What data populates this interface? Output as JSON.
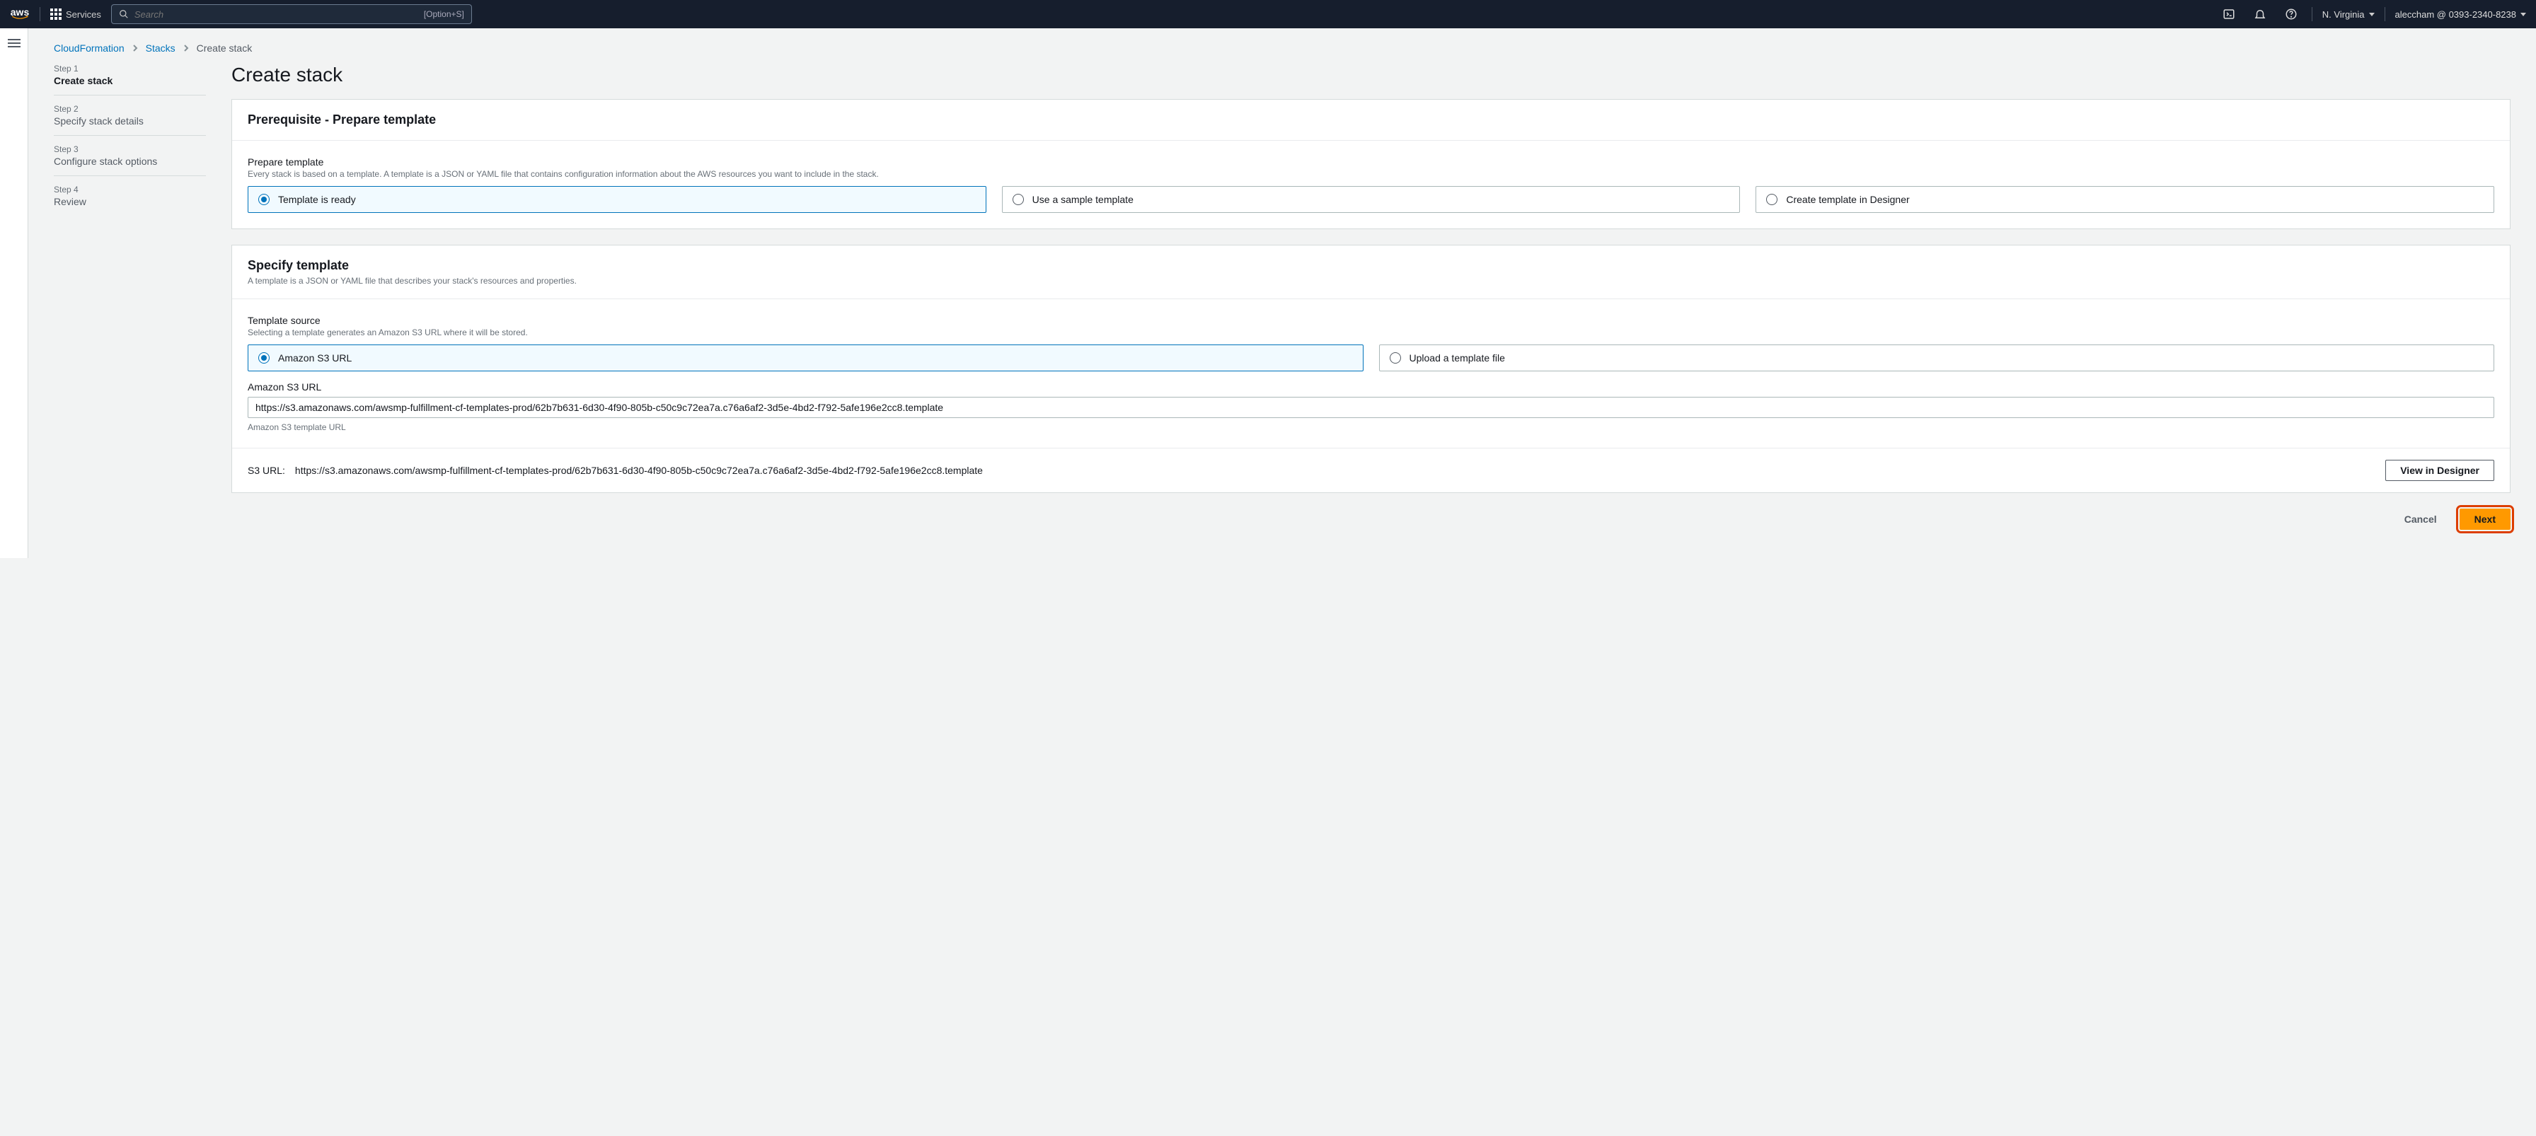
{
  "nav": {
    "logo_text": "aws",
    "services_label": "Services",
    "search_placeholder": "Search",
    "search_hint": "[Option+S]",
    "region": "N. Virginia",
    "account": "aleccham @ 0393-2340-8238"
  },
  "breadcrumb": {
    "items": [
      "CloudFormation",
      "Stacks",
      "Create stack"
    ]
  },
  "steps": [
    {
      "label": "Step 1",
      "title": "Create stack",
      "active": true
    },
    {
      "label": "Step 2",
      "title": "Specify stack details",
      "active": false
    },
    {
      "label": "Step 3",
      "title": "Configure stack options",
      "active": false
    },
    {
      "label": "Step 4",
      "title": "Review",
      "active": false
    }
  ],
  "page_title": "Create stack",
  "prereq": {
    "heading": "Prerequisite - Prepare template",
    "field_label": "Prepare template",
    "field_help": "Every stack is based on a template. A template is a JSON or YAML file that contains configuration information about the AWS resources you want to include in the stack.",
    "options": [
      "Template is ready",
      "Use a sample template",
      "Create template in Designer"
    ]
  },
  "specify": {
    "heading": "Specify template",
    "sub": "A template is a JSON or YAML file that describes your stack's resources and properties.",
    "source_label": "Template source",
    "source_help": "Selecting a template generates an Amazon S3 URL where it will be stored.",
    "source_options": [
      "Amazon S3 URL",
      "Upload a template file"
    ],
    "url_label": "Amazon S3 URL",
    "url_value": "https://s3.amazonaws.com/awsmp-fulfillment-cf-templates-prod/62b7b631-6d30-4f90-805b-c50c9c72ea7a.c76a6af2-3d5e-4bd2-f792-5afe196e2cc8.template",
    "url_hint": "Amazon S3 template URL",
    "s3url_prefix": "S3 URL:",
    "s3url_value": "https://s3.amazonaws.com/awsmp-fulfillment-cf-templates-prod/62b7b631-6d30-4f90-805b-c50c9c72ea7a.c76a6af2-3d5e-4bd2-f792-5afe196e2cc8.template",
    "view_designer": "View in Designer"
  },
  "buttons": {
    "cancel": "Cancel",
    "next": "Next"
  }
}
